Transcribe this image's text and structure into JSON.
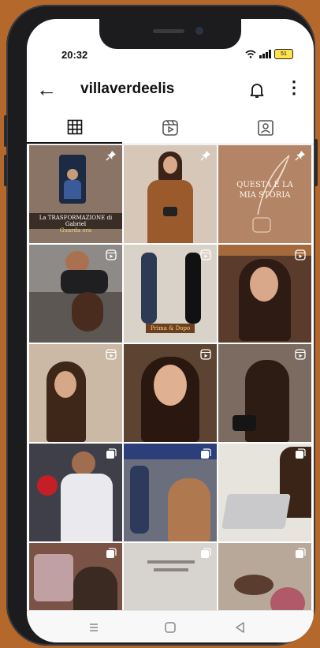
{
  "status": {
    "time": "20:32",
    "battery": "51"
  },
  "header": {
    "username": "villaverdeelis"
  },
  "tabs": [
    {
      "name": "grid-tab-icon"
    },
    {
      "name": "reels-tab-icon"
    },
    {
      "name": "tagged-tab-icon"
    }
  ],
  "posts": [
    {
      "type": "pinned",
      "overlay_title": "La TRASFORMAZIONE di Gabriel",
      "overlay_sub": "Guarda ora",
      "bg": "#8a7466"
    },
    {
      "type": "pinned",
      "bg": "#d6c7b8"
    },
    {
      "type": "pinned",
      "overlay_title": "QUESTA È LA MIA STORIA",
      "bg": "#b38566"
    },
    {
      "type": "reel",
      "bg": "#8e8a87"
    },
    {
      "type": "reel",
      "overlay_title": "Prima & Dopo",
      "bg": "#d9d2c8"
    },
    {
      "type": "reel",
      "bg": "#5b3b2c"
    },
    {
      "type": "reel",
      "bg": "#cbb9a6"
    },
    {
      "type": "reel",
      "bg": "#5c4332"
    },
    {
      "type": "reel",
      "bg": "#7b6b60"
    },
    {
      "type": "carousel",
      "bg": "#3f3f4a"
    },
    {
      "type": "carousel",
      "bg": "#6b6f7d"
    },
    {
      "type": "carousel",
      "bg": "#e7e3dd"
    },
    {
      "type": "carousel",
      "bg": "#7a5246"
    },
    {
      "type": "carousel",
      "bg": "#d7d4d0"
    },
    {
      "type": "carousel",
      "bg": "#b7a89a"
    }
  ],
  "nav": [
    "recent-apps-icon",
    "home-icon",
    "back-nav-icon"
  ]
}
